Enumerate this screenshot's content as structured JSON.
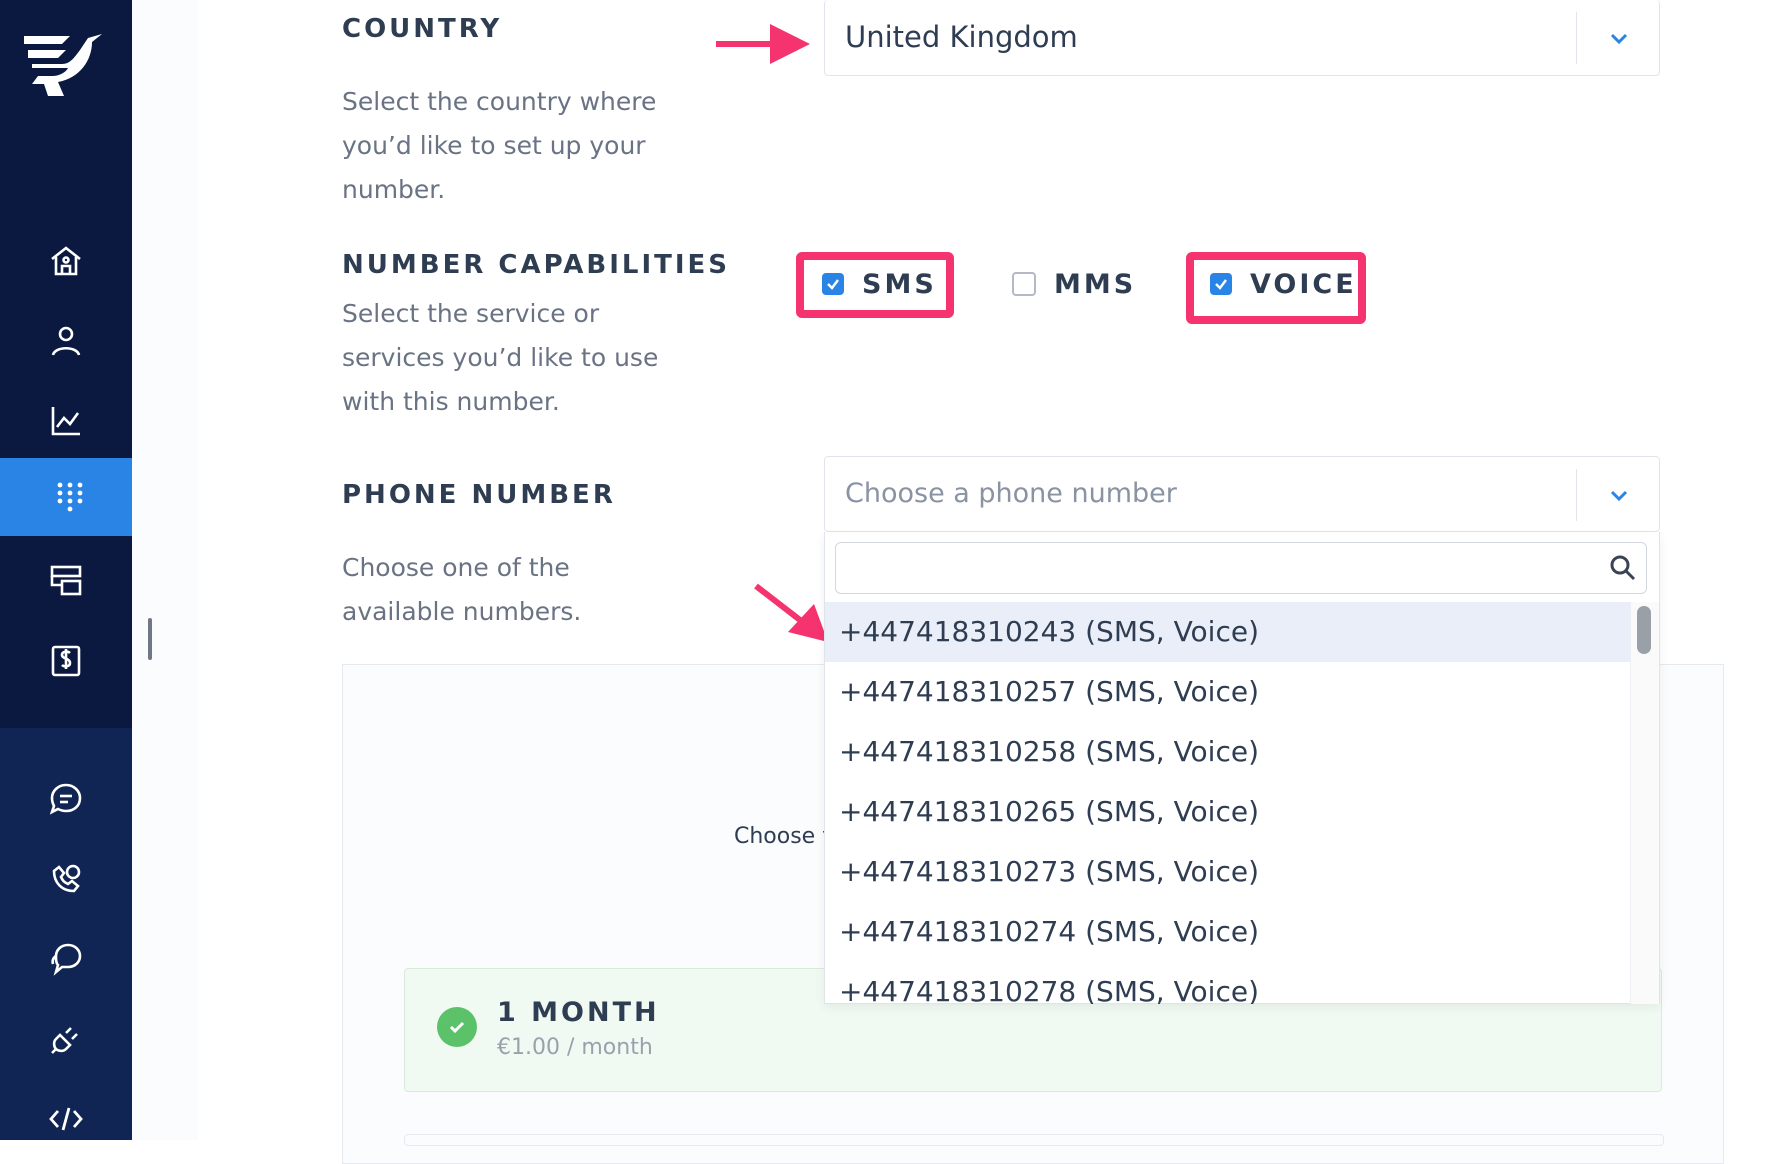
{
  "colors": {
    "sidebar": "#0b1940",
    "accent": "#2a84e6",
    "highlight": "#f4336f",
    "success": "#5bc26a"
  },
  "sidebar": {
    "logo_icon": "messagebird-logo-icon",
    "items": [
      {
        "icon": "home-icon",
        "active": false
      },
      {
        "icon": "user-icon",
        "active": false
      },
      {
        "icon": "analytics-chart-icon",
        "active": false
      },
      {
        "icon": "dialpad-icon",
        "active": true
      },
      {
        "icon": "flows-icon",
        "active": false
      },
      {
        "icon": "billing-icon",
        "active": false
      },
      {
        "icon": "chat-icon",
        "active": false
      },
      {
        "icon": "voice-call-icon",
        "active": false
      },
      {
        "icon": "conversations-icon",
        "active": false
      },
      {
        "icon": "plug-icon",
        "active": false
      },
      {
        "icon": "code-icon",
        "active": false
      }
    ]
  },
  "country": {
    "label": "COUNTRY",
    "description": "Select the country where you’d like to set up your number.",
    "selected": "United Kingdom"
  },
  "capabilities": {
    "label": "NUMBER CAPABILITIES",
    "description": "Select the service or services you’d like to use with this number.",
    "options": [
      {
        "label": "SMS",
        "checked": true,
        "highlighted": true
      },
      {
        "label": "MMS",
        "checked": false,
        "highlighted": false
      },
      {
        "label": "VOICE",
        "checked": true,
        "highlighted": true
      }
    ]
  },
  "phone_number": {
    "label": "PHONE NUMBER",
    "description": "Choose one of the available numbers.",
    "placeholder": "Choose a phone number",
    "search_value": "",
    "options": [
      "+447418310243 (SMS, Voice)",
      "+447418310257 (SMS, Voice)",
      "+447418310258 (SMS, Voice)",
      "+447418310265 (SMS, Voice)",
      "+447418310273 (SMS, Voice)",
      "+447418310274 (SMS, Voice)",
      "+447418310278 (SMS, Voice)"
    ]
  },
  "plans": {
    "choose_text": "Choose y",
    "selected_plan": {
      "name": "1 MONTH",
      "price": "€1.00 / month"
    }
  }
}
